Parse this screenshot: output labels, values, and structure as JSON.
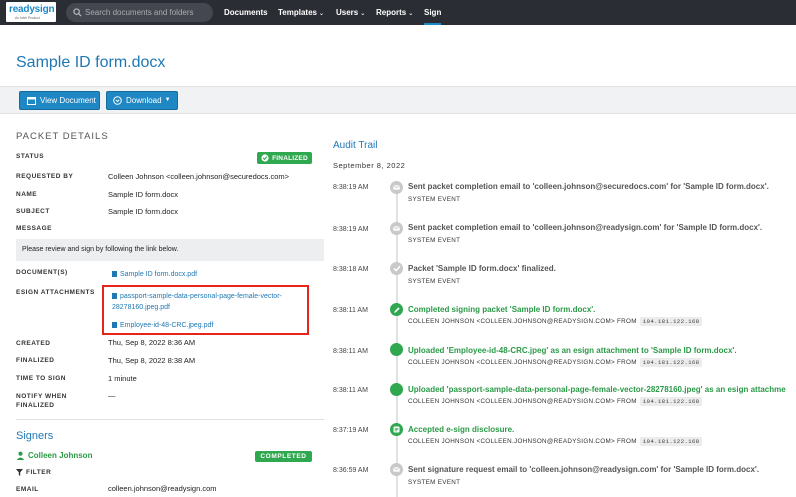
{
  "nav": {
    "logo_text": "readysign",
    "logo_tagline": "An Intel Product",
    "search_placeholder": "Search documents and folders",
    "documents": "Documents",
    "templates": "Templates",
    "users": "Users",
    "reports": "Reports",
    "sign": "Sign"
  },
  "page": {
    "title": "Sample ID form.docx"
  },
  "toolbar": {
    "view_document": "View Document",
    "download": "Download"
  },
  "packet": {
    "section_title": "PACKET DETAILS",
    "status_label": "STATUS",
    "status_value": "FINALIZED",
    "requested_by_label": "REQUESTED BY",
    "requested_by_value": "Colleen Johnson <colleen.johnson@securedocs.com>",
    "name_label": "NAME",
    "name_value": "Sample ID form.docx",
    "subject_label": "SUBJECT",
    "subject_value": "Sample ID form.docx",
    "message_label": "MESSAGE",
    "message_value": "Please review and sign by following the link below.",
    "documents_label": "DOCUMENT(S)",
    "document_link": "Sample ID form.docx.pdf",
    "attachments_label": "ESIGN ATTACHMENTS",
    "attachment_1_line1": "passport-sample-data-personal-page-female-vector-",
    "attachment_1_line2": "28278160.jpeg.pdf",
    "attachment_2": "Employee-id-48-CRC.jpeg.pdf",
    "created_label": "CREATED",
    "created_value": "Thu, Sep 8, 2022 8:36 AM",
    "finalized_label": "FINALIZED",
    "finalized_value": "Thu, Sep 8, 2022 8:38 AM",
    "time_to_sign_label": "TIME TO SIGN",
    "time_to_sign_value": "1 minute",
    "notify_label_1": "NOTIFY WHEN",
    "notify_label_2": "FINALIZED",
    "notify_value": "—"
  },
  "signers": {
    "title": "Signers",
    "name": "Colleen Johnson",
    "status": "COMPLETED",
    "filter_label": "FILTER",
    "email_label": "EMAIL",
    "email_value": "colleen.johnson@readysign.com"
  },
  "audit": {
    "title": "Audit Trail",
    "date": "September 8, 2022",
    "events": [
      {
        "time": "8:38:19 AM",
        "title": "Sent packet completion email to 'colleen.johnson@securedocs.com' for 'Sample ID form.docx'.",
        "sub": "SYSTEM EVENT",
        "ip": ""
      },
      {
        "time": "8:38:19 AM",
        "title": "Sent packet completion email to 'colleen.johnson@readysign.com' for 'Sample ID form.docx'.",
        "sub": "SYSTEM EVENT",
        "ip": ""
      },
      {
        "time": "8:38:18 AM",
        "title": "Packet 'Sample ID form.docx' finalized.",
        "sub": "SYSTEM EVENT",
        "ip": ""
      },
      {
        "time": "8:38:11 AM",
        "title": "Completed signing packet 'Sample ID form.docx'.",
        "sub": "COLLEEN JOHNSON <COLLEEN.JOHNSON@READYSIGN.COM> FROM",
        "ip": "104.181.122.168"
      },
      {
        "time": "8:38:11 AM",
        "title": "Uploaded 'Employee-id-48-CRC.jpeg' as an esign attachment to 'Sample ID form.docx'.",
        "sub": "COLLEEN JOHNSON <COLLEEN.JOHNSON@READYSIGN.COM> FROM",
        "ip": "104.181.122.168"
      },
      {
        "time": "8:38:11 AM",
        "title": "Uploaded 'passport-sample-data-personal-page-female-vector-28278160.jpeg' as an esign attachme",
        "sub": "COLLEEN JOHNSON <COLLEEN.JOHNSON@READYSIGN.COM> FROM",
        "ip": "104.181.122.168"
      },
      {
        "time": "8:37:19 AM",
        "title": "Accepted e-sign disclosure.",
        "sub": "COLLEEN JOHNSON <COLLEEN.JOHNSON@READYSIGN.COM> FROM",
        "ip": "104.181.122.168"
      },
      {
        "time": "8:36:59 AM",
        "title": "Sent signature request email to 'colleen.johnson@readysign.com' for 'Sample ID form.docx'.",
        "sub": "SYSTEM EVENT",
        "ip": ""
      }
    ]
  },
  "colors": {
    "nav_bg": "#2a2d34",
    "accent_blue": "#1e78b4",
    "success_green": "#2fa84f",
    "highlight_red": "#e8231c"
  }
}
